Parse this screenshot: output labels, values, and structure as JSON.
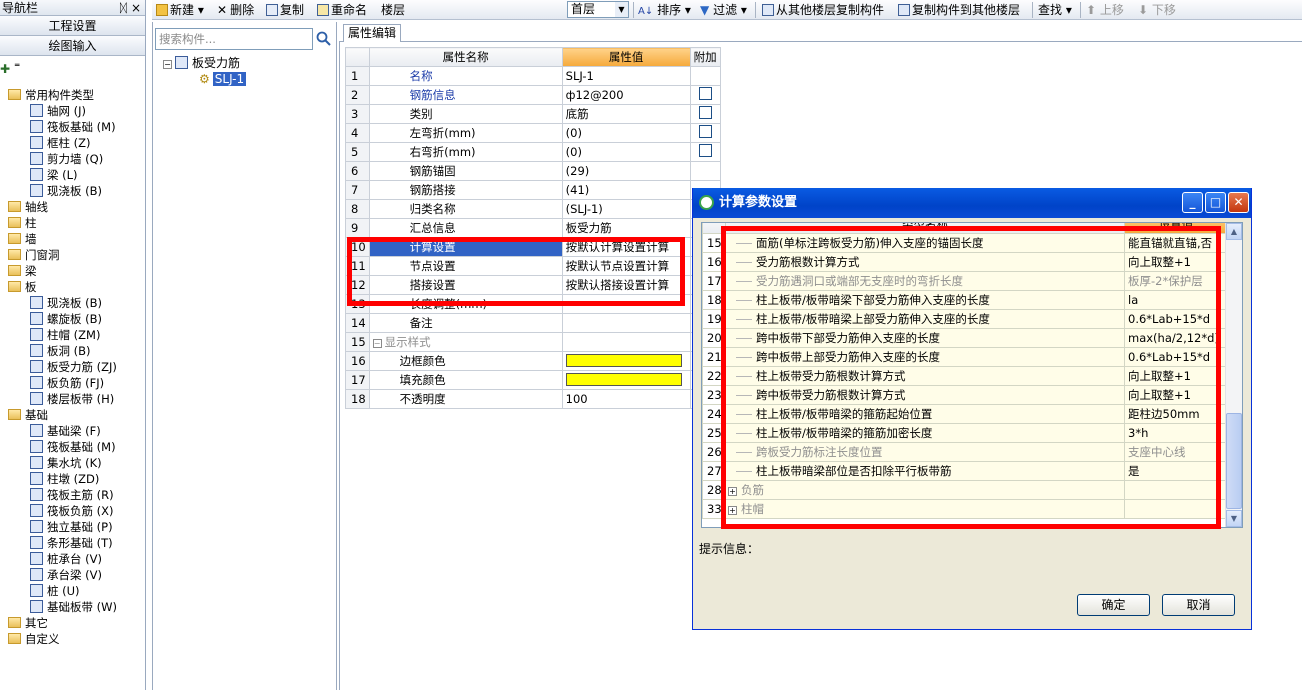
{
  "nav": {
    "title": "导航栏",
    "pin": "ᛞ",
    "close": "×",
    "btn_project": "工程设置",
    "btn_drawing": "绘图输入",
    "tree": [
      {
        "label": "常用构件类型",
        "type": "folder",
        "level": "top"
      },
      {
        "label": "轴网 (J)",
        "type": "item",
        "level": "sub"
      },
      {
        "label": "筏板基础 (M)",
        "type": "item",
        "level": "sub"
      },
      {
        "label": "框柱 (Z)",
        "type": "item",
        "level": "sub"
      },
      {
        "label": "剪力墙 (Q)",
        "type": "item",
        "level": "sub"
      },
      {
        "label": "梁 (L)",
        "type": "item",
        "level": "sub"
      },
      {
        "label": "现浇板 (B)",
        "type": "item",
        "level": "sub"
      },
      {
        "label": "轴线",
        "type": "folder",
        "level": "top"
      },
      {
        "label": "柱",
        "type": "folder",
        "level": "top"
      },
      {
        "label": "墙",
        "type": "folder",
        "level": "top"
      },
      {
        "label": "门窗洞",
        "type": "folder",
        "level": "top"
      },
      {
        "label": "梁",
        "type": "folder",
        "level": "top"
      },
      {
        "label": "板",
        "type": "folder",
        "level": "top"
      },
      {
        "label": "现浇板 (B)",
        "type": "item",
        "level": "sub"
      },
      {
        "label": "螺旋板 (B)",
        "type": "item",
        "level": "sub"
      },
      {
        "label": "柱帽 (ZM)",
        "type": "item",
        "level": "sub"
      },
      {
        "label": "板洞 (B)",
        "type": "item",
        "level": "sub"
      },
      {
        "label": "板受力筋 (ZJ)",
        "type": "item",
        "level": "sub"
      },
      {
        "label": "板负筋 (FJ)",
        "type": "item",
        "level": "sub"
      },
      {
        "label": "楼层板带 (H)",
        "type": "item",
        "level": "sub"
      },
      {
        "label": "基础",
        "type": "folder",
        "level": "top"
      },
      {
        "label": "基础梁 (F)",
        "type": "item",
        "level": "sub"
      },
      {
        "label": "筏板基础 (M)",
        "type": "item",
        "level": "sub"
      },
      {
        "label": "集水坑 (K)",
        "type": "item",
        "level": "sub"
      },
      {
        "label": "柱墩 (ZD)",
        "type": "item",
        "level": "sub"
      },
      {
        "label": "筏板主筋 (R)",
        "type": "item",
        "level": "sub"
      },
      {
        "label": "筏板负筋 (X)",
        "type": "item",
        "level": "sub"
      },
      {
        "label": "独立基础 (P)",
        "type": "item",
        "level": "sub"
      },
      {
        "label": "条形基础 (T)",
        "type": "item",
        "level": "sub"
      },
      {
        "label": "桩承台 (V)",
        "type": "item",
        "level": "sub"
      },
      {
        "label": "承台梁 (V)",
        "type": "item",
        "level": "sub"
      },
      {
        "label": "桩 (U)",
        "type": "item",
        "level": "sub"
      },
      {
        "label": "基础板带 (W)",
        "type": "item",
        "level": "sub"
      },
      {
        "label": "其它",
        "type": "folder",
        "level": "top"
      },
      {
        "label": "自定义",
        "type": "folder",
        "level": "top"
      }
    ]
  },
  "toolbar": {
    "new": "新建",
    "delete": "删除",
    "copy": "复制",
    "rename": "重命名",
    "floor_label": "楼层",
    "floor_value": "首层",
    "sort": "排序",
    "filter": "过滤",
    "copy_from_floor": "从其他楼层复制构件",
    "copy_to_floor": "复制构件到其他楼层",
    "find": "查找",
    "move_up": "上移",
    "move_down": "下移"
  },
  "component_panel": {
    "search_placeholder": "搜索构件...",
    "root": "板受力筋",
    "child": "SLJ-1"
  },
  "properties": {
    "tab": "属性编辑",
    "headers": {
      "name": "属性名称",
      "value": "属性值",
      "extra": "附加"
    },
    "rows": [
      {
        "no": "1",
        "name": "名称",
        "value": "SLJ-1",
        "blue": true,
        "cb": false
      },
      {
        "no": "2",
        "name": "钢筋信息",
        "value": "ф12@200",
        "blue": true,
        "cb": true
      },
      {
        "no": "3",
        "name": "类别",
        "value": "底筋",
        "blue": false,
        "cb": true
      },
      {
        "no": "4",
        "name": "左弯折(mm)",
        "value": "(0)",
        "blue": false,
        "cb": true
      },
      {
        "no": "5",
        "name": "右弯折(mm)",
        "value": "(0)",
        "blue": false,
        "cb": true
      },
      {
        "no": "6",
        "name": "钢筋锚固",
        "value": "(29)",
        "blue": false,
        "cb": false
      },
      {
        "no": "7",
        "name": "钢筋搭接",
        "value": "(41)",
        "blue": false,
        "cb": false
      },
      {
        "no": "8",
        "name": "归类名称",
        "value": "(SLJ-1)",
        "blue": false,
        "cb": false
      },
      {
        "no": "9",
        "name": "汇总信息",
        "value": "板受力筋",
        "blue": false,
        "cb": false
      },
      {
        "no": "10",
        "name": "计算设置",
        "value": "按默认计算设置计算",
        "blue": false,
        "cb": false,
        "hl": true
      },
      {
        "no": "11",
        "name": "节点设置",
        "value": "按默认节点设置计算",
        "blue": false,
        "cb": false
      },
      {
        "no": "12",
        "name": "搭接设置",
        "value": "按默认搭接设置计算",
        "blue": false,
        "cb": false
      },
      {
        "no": "13",
        "name": "长度调整(mm)",
        "value": "",
        "blue": false,
        "cb": false
      },
      {
        "no": "14",
        "name": "备注",
        "value": "",
        "blue": false,
        "cb": false
      },
      {
        "no": "15",
        "name": "显示样式",
        "value": "",
        "group": true
      },
      {
        "no": "16",
        "name": "边框颜色",
        "value": "",
        "swatch": "#ffff00",
        "child": true
      },
      {
        "no": "17",
        "name": "填充颜色",
        "value": "",
        "swatch": "#ffff00",
        "child": true
      },
      {
        "no": "18",
        "name": "不透明度",
        "value": "100",
        "child": true
      }
    ]
  },
  "dialog": {
    "title": "计算参数设置",
    "headers": {
      "name": "类型名称",
      "value": "设置值"
    },
    "rows": [
      {
        "no": "15",
        "name": "面筋(单标注跨板受力筋)伸入支座的锚固长度",
        "value": "能直锚就直锚,否",
        "gray": false
      },
      {
        "no": "16",
        "name": "受力筋根数计算方式",
        "value": "向上取整+1",
        "gray": false
      },
      {
        "no": "17",
        "name": "受力筋遇洞口或端部无支座时的弯折长度",
        "value": "板厚-2*保护层",
        "gray": true
      },
      {
        "no": "18",
        "name": "柱上板带/板带暗梁下部受力筋伸入支座的长度",
        "value": "la",
        "gray": false
      },
      {
        "no": "19",
        "name": "柱上板带/板带暗梁上部受力筋伸入支座的长度",
        "value": "0.6*Lab+15*d",
        "gray": false
      },
      {
        "no": "20",
        "name": "跨中板带下部受力筋伸入支座的长度",
        "value": "max(ha/2,12*d)",
        "gray": false
      },
      {
        "no": "21",
        "name": "跨中板带上部受力筋伸入支座的长度",
        "value": "0.6*Lab+15*d",
        "gray": false
      },
      {
        "no": "22",
        "name": "柱上板带受力筋根数计算方式",
        "value": "向上取整+1",
        "gray": false
      },
      {
        "no": "23",
        "name": "跨中板带受力筋根数计算方式",
        "value": "向上取整+1",
        "gray": false
      },
      {
        "no": "24",
        "name": "柱上板带/板带暗梁的箍筋起始位置",
        "value": "距柱边50mm",
        "gray": false
      },
      {
        "no": "25",
        "name": "柱上板带/板带暗梁的箍筋加密长度",
        "value": "3*h",
        "gray": false
      },
      {
        "no": "26",
        "name": "跨板受力筋标注长度位置",
        "value": "支座中心线",
        "gray": true
      },
      {
        "no": "27",
        "name": "柱上板带暗梁部位是否扣除平行板带筋",
        "value": "是",
        "gray": false
      },
      {
        "no": "28",
        "name": "负筋",
        "value": "",
        "group": true
      },
      {
        "no": "33",
        "name": "柱帽",
        "value": "",
        "group": true
      }
    ],
    "hint_label": "提示信息：",
    "ok": "确定",
    "cancel": "取消"
  }
}
